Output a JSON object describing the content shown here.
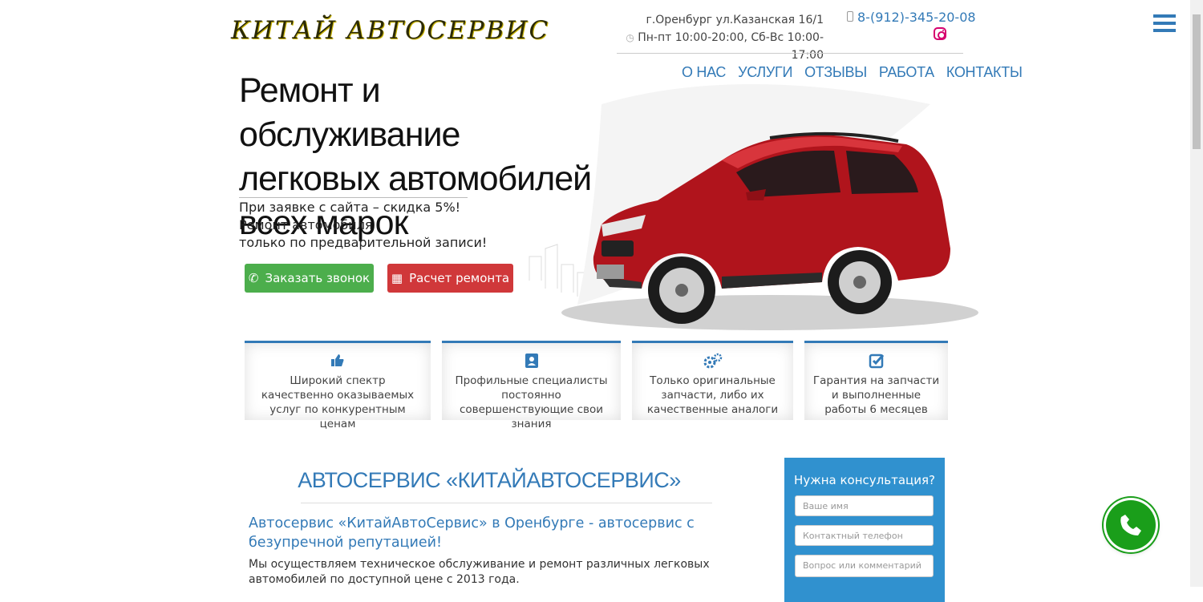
{
  "header": {
    "logo": "КИТАЙ АВТОСЕРВИС",
    "address": "г.Оренбург ул.Казанская 16/1",
    "hours": "Пн-пт 10:00-20:00, Сб-Вс 10:00-17:00",
    "phone": "8-(912)-345-20-08",
    "nav": [
      "О НАС",
      "УСЛУГИ",
      "ОТЗЫВЫ",
      "РАБОТА",
      "КОНТАКТЫ"
    ]
  },
  "hero": {
    "title": "Ремонт и обслуживание легковых автомобилей всех марок",
    "sub_line1": "При заявке с сайта – скидка 5%!",
    "sub_line2": "Ремонт автомобиля",
    "sub_line3": "только по предварительной записи!",
    "btn_call": "Заказать звонок",
    "btn_calc": "Расчет ремонта"
  },
  "features": [
    {
      "icon": "thumbs-up-icon",
      "text": "Широкий спектр качественно оказываемых услуг по конкурентным ценам"
    },
    {
      "icon": "contact-card-icon",
      "text": "Профильные специалисты постоянно совершенствующие свои знания"
    },
    {
      "icon": "gears-icon",
      "text": "Только оригинальные запчасти, либо их качественные аналоги"
    },
    {
      "icon": "checkbox-icon",
      "text": "Гарантия на запчасти и выполненные работы 6 месяцев"
    }
  ],
  "about": {
    "title": "АВТОСЕРВИС «КИТАЙАВТОСЕРВИС»",
    "lead": "Автосервис «КитайАвтоСервис» в Оренбурге - автосервис с безупречной репутацией!",
    "text": "Мы осуществляем техническое обслуживание и ремонт различных легковых автомобилей по доступной цене с 2013 года."
  },
  "consult": {
    "title": "Нужна консультация?",
    "name_placeholder": "Ваше имя",
    "phone_placeholder": "Контактный телефон",
    "question_placeholder": "Вопрос или комментарий"
  },
  "colors": {
    "accent": "#337ab7",
    "green": "#4cae4c",
    "red": "#d0383a",
    "form_bg": "#3091cf",
    "car": "#b0141c"
  }
}
